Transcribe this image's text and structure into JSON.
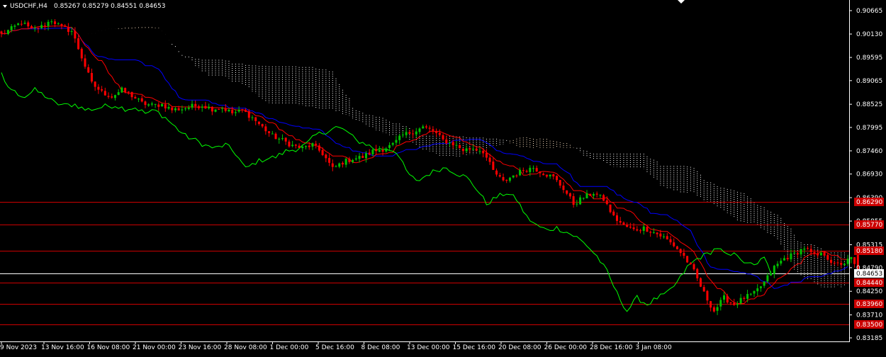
{
  "header": {
    "symbol": "USDCHF,H4",
    "ohlc": "0.85267 0.85279 0.84551 0.84653"
  },
  "colors": {
    "background": "#000000",
    "bull_candle": "#00c000",
    "bear_candle": "#ff0000",
    "tenkan": "#ff0000",
    "kijun": "#0000ff",
    "chikou": "#00ff00",
    "cloud_bull": "#ffe4c4",
    "cloud_bear": "#ffffff",
    "level_line": "#cc0000",
    "current_price_line": "#ffffff",
    "axis_text": "#ffffff"
  },
  "icons": {
    "menu": "triangle-down-icon",
    "shift_marker": "triangle-down-icon"
  },
  "chart_data": {
    "type": "candlestick",
    "price_axis_ticks": [
      "0.90665",
      "0.90130",
      "0.89595",
      "0.89065",
      "0.88525",
      "0.87995",
      "0.87460",
      "0.86930",
      "0.86390",
      "0.85855",
      "0.85315",
      "0.84790",
      "0.84250",
      "0.83710",
      "0.83185"
    ],
    "ylim": [
      0.8318,
      0.9073
    ],
    "time_axis_labels": [
      "9 Nov 2023",
      "13 Nov 16:00",
      "16 Nov 08:00",
      "21 Nov 00:00",
      "23 Nov 16:00",
      "28 Nov 08:00",
      "1 Dec 00:00",
      "5 Dec 16:00",
      "8 Dec 08:00",
      "13 Dec 00:00",
      "15 Dec 16:00",
      "20 Dec 08:00",
      "26 Dec 00:00",
      "28 Dec 16:00",
      "3 Jan 08:00"
    ],
    "horizontal_levels": [
      {
        "label": "0.86290",
        "value": 0.8629
      },
      {
        "label": "0.85770",
        "value": 0.8577
      },
      {
        "label": "0.85180",
        "value": 0.8518
      },
      {
        "label": "0.84440",
        "value": 0.8444
      },
      {
        "label": "0.83960",
        "value": 0.8396
      },
      {
        "label": "0.83500",
        "value": 0.835
      }
    ],
    "current_price": {
      "label": "0.84653",
      "value": 0.84653
    },
    "price_anchors": [
      [
        0,
        0.9012
      ],
      [
        3,
        0.9025
      ],
      [
        6,
        0.904
      ],
      [
        9,
        0.9022
      ],
      [
        12,
        0.903
      ],
      [
        15,
        0.9045
      ],
      [
        18,
        0.9028
      ],
      [
        21,
        0.902
      ],
      [
        24,
        0.896
      ],
      [
        27,
        0.89
      ],
      [
        30,
        0.888
      ],
      [
        33,
        0.887
      ],
      [
        36,
        0.8885
      ],
      [
        39,
        0.8872
      ],
      [
        42,
        0.8855
      ],
      [
        45,
        0.885
      ],
      [
        48,
        0.8852
      ],
      [
        51,
        0.884
      ],
      [
        54,
        0.8842
      ],
      [
        57,
        0.8848
      ],
      [
        60,
        0.885
      ],
      [
        63,
        0.8842
      ],
      [
        66,
        0.8845
      ],
      [
        69,
        0.8832
      ],
      [
        72,
        0.8838
      ],
      [
        75,
        0.8822
      ],
      [
        78,
        0.88
      ],
      [
        81,
        0.878
      ],
      [
        84,
        0.877
      ],
      [
        87,
        0.8758
      ],
      [
        90,
        0.8752
      ],
      [
        93,
        0.876
      ],
      [
        96,
        0.874
      ],
      [
        99,
        0.8705
      ],
      [
        102,
        0.872
      ],
      [
        105,
        0.8728
      ],
      [
        108,
        0.8732
      ],
      [
        111,
        0.8745
      ],
      [
        114,
        0.875
      ],
      [
        117,
        0.876
      ],
      [
        120,
        0.8782
      ],
      [
        123,
        0.879
      ],
      [
        126,
        0.88
      ],
      [
        129,
        0.8792
      ],
      [
        132,
        0.877
      ],
      [
        135,
        0.8762
      ],
      [
        138,
        0.8748
      ],
      [
        141,
        0.8752
      ],
      [
        144,
        0.8745
      ],
      [
        147,
        0.87
      ],
      [
        150,
        0.8675
      ],
      [
        153,
        0.869
      ],
      [
        156,
        0.8702
      ],
      [
        159,
        0.8708
      ],
      [
        162,
        0.8695
      ],
      [
        165,
        0.8685
      ],
      [
        168,
        0.866
      ],
      [
        171,
        0.8625
      ],
      [
        174,
        0.864
      ],
      [
        177,
        0.865
      ],
      [
        180,
        0.8635
      ],
      [
        183,
        0.8595
      ],
      [
        186,
        0.8575
      ],
      [
        189,
        0.8565
      ],
      [
        192,
        0.857
      ],
      [
        195,
        0.856
      ],
      [
        198,
        0.8548
      ],
      [
        201,
        0.853
      ],
      [
        204,
        0.8505
      ],
      [
        207,
        0.847
      ],
      [
        210,
        0.842
      ],
      [
        213,
        0.838
      ],
      [
        216,
        0.841
      ],
      [
        219,
        0.8395
      ],
      [
        222,
        0.841
      ],
      [
        225,
        0.842
      ],
      [
        228,
        0.8445
      ],
      [
        231,
        0.848
      ],
      [
        234,
        0.85
      ],
      [
        237,
        0.851
      ],
      [
        240,
        0.8525
      ],
      [
        243,
        0.8505
      ],
      [
        246,
        0.851
      ],
      [
        249,
        0.8485
      ],
      [
        252,
        0.849
      ],
      [
        254,
        0.85
      ],
      [
        256,
        0.847
      ]
    ],
    "n_candles": 257,
    "ichimoku": {
      "tenkan": 9,
      "kijun": 26,
      "senkou_b": 52,
      "shift": 26
    }
  }
}
